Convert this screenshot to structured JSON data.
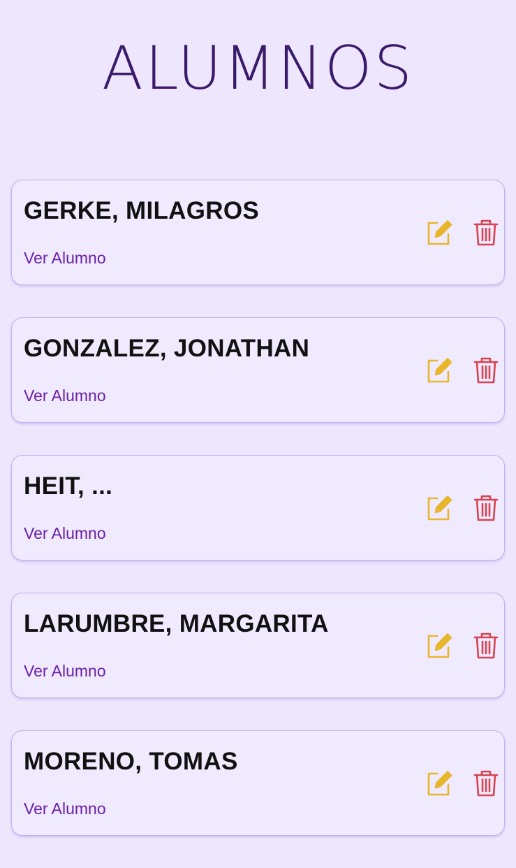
{
  "page": {
    "title": "ALUMNOS"
  },
  "colors": {
    "background": "#ede6fd",
    "title": "#3a1a6b",
    "link": "#6a1fa8",
    "edit_icon": "#e8b62c",
    "delete_icon": "#d9434f",
    "card_border": "#c3b0f0"
  },
  "icons": {
    "edit": "edit-icon",
    "delete": "trash-icon"
  },
  "students": [
    {
      "name": "GERKE, MILAGROS",
      "link_label": "Ver Alumno"
    },
    {
      "name": "GONZALEZ, JONATHAN",
      "link_label": "Ver Alumno"
    },
    {
      "name": "HEIT, ...",
      "link_label": "Ver Alumno"
    },
    {
      "name": "LARUMBRE, MARGARITA",
      "link_label": "Ver Alumno"
    },
    {
      "name": "MORENO, TOMAS",
      "link_label": "Ver Alumno"
    }
  ]
}
